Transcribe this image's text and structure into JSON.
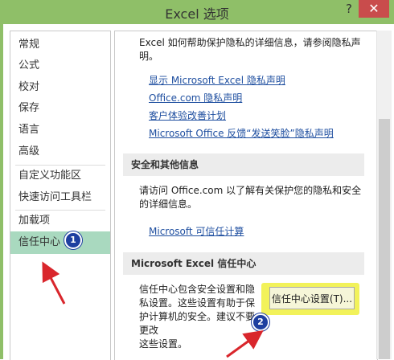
{
  "window": {
    "title": "Excel 选项",
    "help": "?",
    "close": "✕"
  },
  "sidebar": {
    "items": [
      {
        "label": "常规"
      },
      {
        "label": "公式"
      },
      {
        "label": "校对"
      },
      {
        "label": "保存"
      },
      {
        "label": "语言"
      },
      {
        "label": "高级"
      },
      {
        "label": "自定义功能区"
      },
      {
        "label": "快速访问工具栏"
      },
      {
        "label": "加载项"
      },
      {
        "label": "信任中心",
        "selected": true
      }
    ]
  },
  "main": {
    "intro_line1": "Excel 如何帮助保护隐私的详细信息，请参阅隐私声",
    "intro_line2": "明。",
    "links": [
      "显示 Microsoft Excel 隐私声明",
      "Office.com 隐私声明",
      "客户体验改善计划",
      "Microsoft Office 反馈“发送笑脸”隐私声明"
    ],
    "security_section": {
      "title": "安全和其他信息",
      "text_line1": "请访问 Office.com 以了解有关保护您的隐私和安全",
      "text_line2": "的详细信息。",
      "link": "Microsoft 可信任计算"
    },
    "trust_section": {
      "title": "Microsoft Excel 信任中心",
      "text_lines": [
        "信任中心包含安全设置和隐",
        "私设置。这些设置有助于保",
        "护计算机的安全。建议不要",
        "更改",
        "这些设置。"
      ],
      "button_label": "信任中心设置(T)..."
    }
  },
  "annotations": {
    "badge1": "1",
    "badge2": "2",
    "highlight_color": "#f2f25a",
    "badge_color": "#1e3fa0",
    "arrow_color": "#d9262c"
  }
}
